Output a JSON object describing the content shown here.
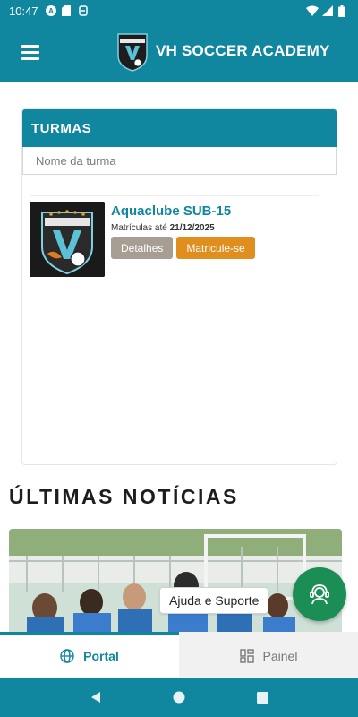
{
  "status_bar": {
    "time": "10:47",
    "left_icons": [
      "a-circle-icon",
      "sd-card-icon",
      "sync-icon"
    ],
    "right_icons": [
      "wifi-icon",
      "signal-icon",
      "battery-icon"
    ]
  },
  "app_bar": {
    "title": "VH SOCCER ACADEMY",
    "menu_icon": "hamburger-menu-icon",
    "logo": "vh-soccer-academy-logo"
  },
  "turmas": {
    "header": "TURMAS",
    "search_placeholder": "Nome da turma",
    "items": [
      {
        "title": "Aquaclube SUB-15",
        "enroll_prefix": "Matrículas até",
        "enroll_date": "21/12/2025",
        "details_label": "Detalhes",
        "enroll_label": "Matricule-se"
      }
    ]
  },
  "news": {
    "title": "ÚLTIMAS NOTÍCIAS"
  },
  "help": {
    "label": "Ajuda e Suporte",
    "icon": "support-agent-icon"
  },
  "bottom_nav": {
    "tabs": [
      {
        "label": "Portal",
        "icon": "globe-icon",
        "active": true
      },
      {
        "label": "Painel",
        "icon": "dashboard-icon",
        "active": false
      }
    ]
  },
  "system_nav": [
    "back-icon",
    "home-icon",
    "recents-icon"
  ],
  "colors": {
    "primary": "#11869f",
    "details_button": "#a79e93",
    "enroll_button": "#e08f1f",
    "help_fab": "#1b8e55"
  }
}
